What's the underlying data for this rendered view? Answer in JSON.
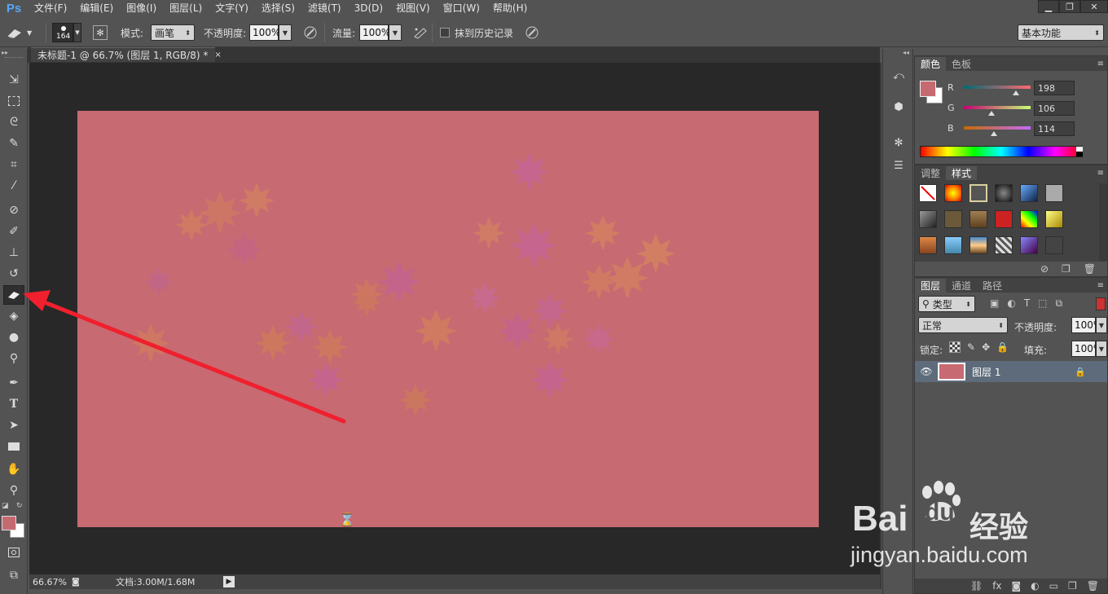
{
  "app": {
    "logo": "Ps",
    "menu": [
      "文件(F)",
      "编辑(E)",
      "图像(I)",
      "图层(L)",
      "文字(Y)",
      "选择(S)",
      "滤镜(T)",
      "3D(D)",
      "视图(V)",
      "窗口(W)",
      "帮助(H)"
    ],
    "window_controls": [
      "minimize-icon",
      "restore-icon",
      "close-icon"
    ],
    "workspace": "基本功能"
  },
  "options": {
    "brush_size": "164",
    "mode_label": "模式:",
    "mode_value": "画笔",
    "opacity_label": "不透明度:",
    "opacity_value": "100%",
    "flow_label": "流量:",
    "flow_value": "100%",
    "erase_history_label": "抹到历史记录"
  },
  "document": {
    "tab_title": "未标题-1 @ 66.7% (图层 1, RGB/8) *",
    "tab_close": "×",
    "canvas_color": "#c76a72",
    "zoom": "66.67%",
    "doc_size": "文档:3.00M/1.68M"
  },
  "toolbar": {
    "active_tool": "eraser-tool",
    "foreground_color": "#c66a72",
    "background_color": "#ffffff"
  },
  "color_panel": {
    "tabs": [
      "颜色",
      "色板"
    ],
    "channels": [
      {
        "label": "R",
        "value": "198",
        "fraction": 0.776
      },
      {
        "label": "G",
        "value": "106",
        "fraction": 0.416
      },
      {
        "label": "B",
        "value": "114",
        "fraction": 0.447
      }
    ]
  },
  "styles_panel": {
    "tabs": [
      "调整",
      "样式"
    ]
  },
  "layers_panel": {
    "tabs": [
      "图层",
      "通道",
      "路径"
    ],
    "filter_label": "类型",
    "blend_mode": "正常",
    "opacity_label": "不透明度:",
    "opacity_value": "100%",
    "lock_label": "锁定:",
    "fill_label": "填充:",
    "fill_value": "100%",
    "layers": [
      {
        "name": "图层 1",
        "thumb_color": "#c76a72"
      }
    ]
  },
  "watermark": {
    "brand_left": "Bai",
    "brand_right": "du",
    "suffix": "经验",
    "url": "jingyan.baidu.com"
  }
}
